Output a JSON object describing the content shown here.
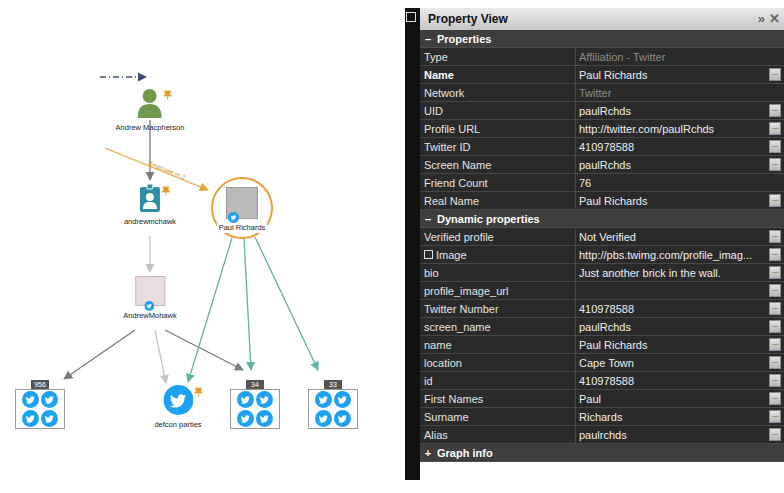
{
  "graph": {
    "nodes": [
      {
        "label": "Andrew Macpherson",
        "kind": "person",
        "pinned": true,
        "selected": false,
        "count": ""
      },
      {
        "label": "andrewmchawk",
        "kind": "alias",
        "pinned": true,
        "selected": false,
        "count": ""
      },
      {
        "label": "AndrewMohawk",
        "kind": "image",
        "pinned": false,
        "selected": false,
        "count": ""
      },
      {
        "label": "Paul Richards",
        "kind": "photo",
        "pinned": false,
        "selected": true,
        "count": ""
      },
      {
        "label": "",
        "kind": "group",
        "pinned": false,
        "selected": false,
        "count": "956"
      },
      {
        "label": "defcon parties",
        "kind": "twitter",
        "pinned": true,
        "selected": false,
        "count": ""
      },
      {
        "label": "",
        "kind": "group",
        "pinned": false,
        "selected": false,
        "count": "34"
      },
      {
        "label": "",
        "kind": "group",
        "pinned": false,
        "selected": false,
        "count": "33"
      }
    ],
    "edge_label": "Employee nr 2"
  },
  "panel": {
    "title": "Property View",
    "title_buttons": [
      "»",
      "✕"
    ],
    "button_label": "...",
    "sections": [
      {
        "icon": "–",
        "title": "Properties",
        "expanded": true,
        "rows": [
          {
            "key": "Type",
            "value": "Affiliation - Twitter",
            "kind": "text",
            "checked": false,
            "bold": false,
            "muted": true,
            "button": false
          },
          {
            "key": "Name",
            "value": "Paul Richards",
            "kind": "text",
            "checked": false,
            "bold": true,
            "muted": false,
            "button": true
          },
          {
            "key": "Network",
            "value": "Twitter",
            "kind": "text",
            "checked": false,
            "bold": false,
            "muted": true,
            "button": false
          },
          {
            "key": "UID",
            "value": "paulRchds",
            "kind": "text",
            "checked": false,
            "bold": false,
            "muted": false,
            "button": true
          },
          {
            "key": "Profile URL",
            "value": "http://twitter.com/paulRchds",
            "kind": "text",
            "checked": false,
            "bold": false,
            "muted": false,
            "button": true
          },
          {
            "key": "Twitter ID",
            "value": "410978588",
            "kind": "text",
            "checked": false,
            "bold": false,
            "muted": false,
            "button": true
          },
          {
            "key": "Screen Name",
            "value": "paulRchds",
            "kind": "text",
            "checked": false,
            "bold": false,
            "muted": false,
            "button": true
          },
          {
            "key": "Friend Count",
            "value": "76",
            "kind": "text",
            "checked": false,
            "bold": false,
            "muted": false,
            "button": false
          },
          {
            "key": "Real Name",
            "value": "Paul Richards",
            "kind": "text",
            "checked": false,
            "bold": false,
            "muted": false,
            "button": true
          }
        ]
      },
      {
        "icon": "–",
        "title": "Dynamic properties",
        "expanded": true,
        "rows": [
          {
            "key": "Verified profile",
            "value": "Not Verified",
            "kind": "text",
            "checked": false,
            "bold": false,
            "muted": false,
            "button": true
          },
          {
            "key": "Image",
            "value": "http://pbs.twimg.com/profile_imag...",
            "kind": "checkbox",
            "checked": false,
            "bold": false,
            "muted": false,
            "button": true
          },
          {
            "key": "bio",
            "value": "Just another brick in the wall.",
            "kind": "text",
            "checked": false,
            "bold": false,
            "muted": false,
            "button": true
          },
          {
            "key": "profile_image_url",
            "value": "",
            "kind": "text",
            "checked": false,
            "bold": false,
            "muted": false,
            "button": true
          },
          {
            "key": "Twitter Number",
            "value": "410978588",
            "kind": "text",
            "checked": false,
            "bold": false,
            "muted": false,
            "button": true
          },
          {
            "key": "screen_name",
            "value": "paulRchds",
            "kind": "text",
            "checked": false,
            "bold": false,
            "muted": false,
            "button": true
          },
          {
            "key": "name",
            "value": "Paul Richards",
            "kind": "text",
            "checked": false,
            "bold": false,
            "muted": false,
            "button": true
          },
          {
            "key": "location",
            "value": "Cape Town",
            "kind": "text",
            "checked": false,
            "bold": false,
            "muted": false,
            "button": true
          },
          {
            "key": "id",
            "value": "410978588",
            "kind": "text",
            "checked": false,
            "bold": false,
            "muted": false,
            "button": true
          },
          {
            "key": "First Names",
            "value": "Paul",
            "kind": "text",
            "checked": false,
            "bold": false,
            "muted": false,
            "button": true
          },
          {
            "key": "Surname",
            "value": "Richards",
            "kind": "text",
            "checked": false,
            "bold": false,
            "muted": false,
            "button": true
          },
          {
            "key": "Alias",
            "value": "paulrchds",
            "kind": "text",
            "checked": false,
            "bold": false,
            "muted": false,
            "button": true
          }
        ]
      },
      {
        "icon": "+",
        "title": "Graph info",
        "expanded": false,
        "rows": []
      }
    ]
  }
}
